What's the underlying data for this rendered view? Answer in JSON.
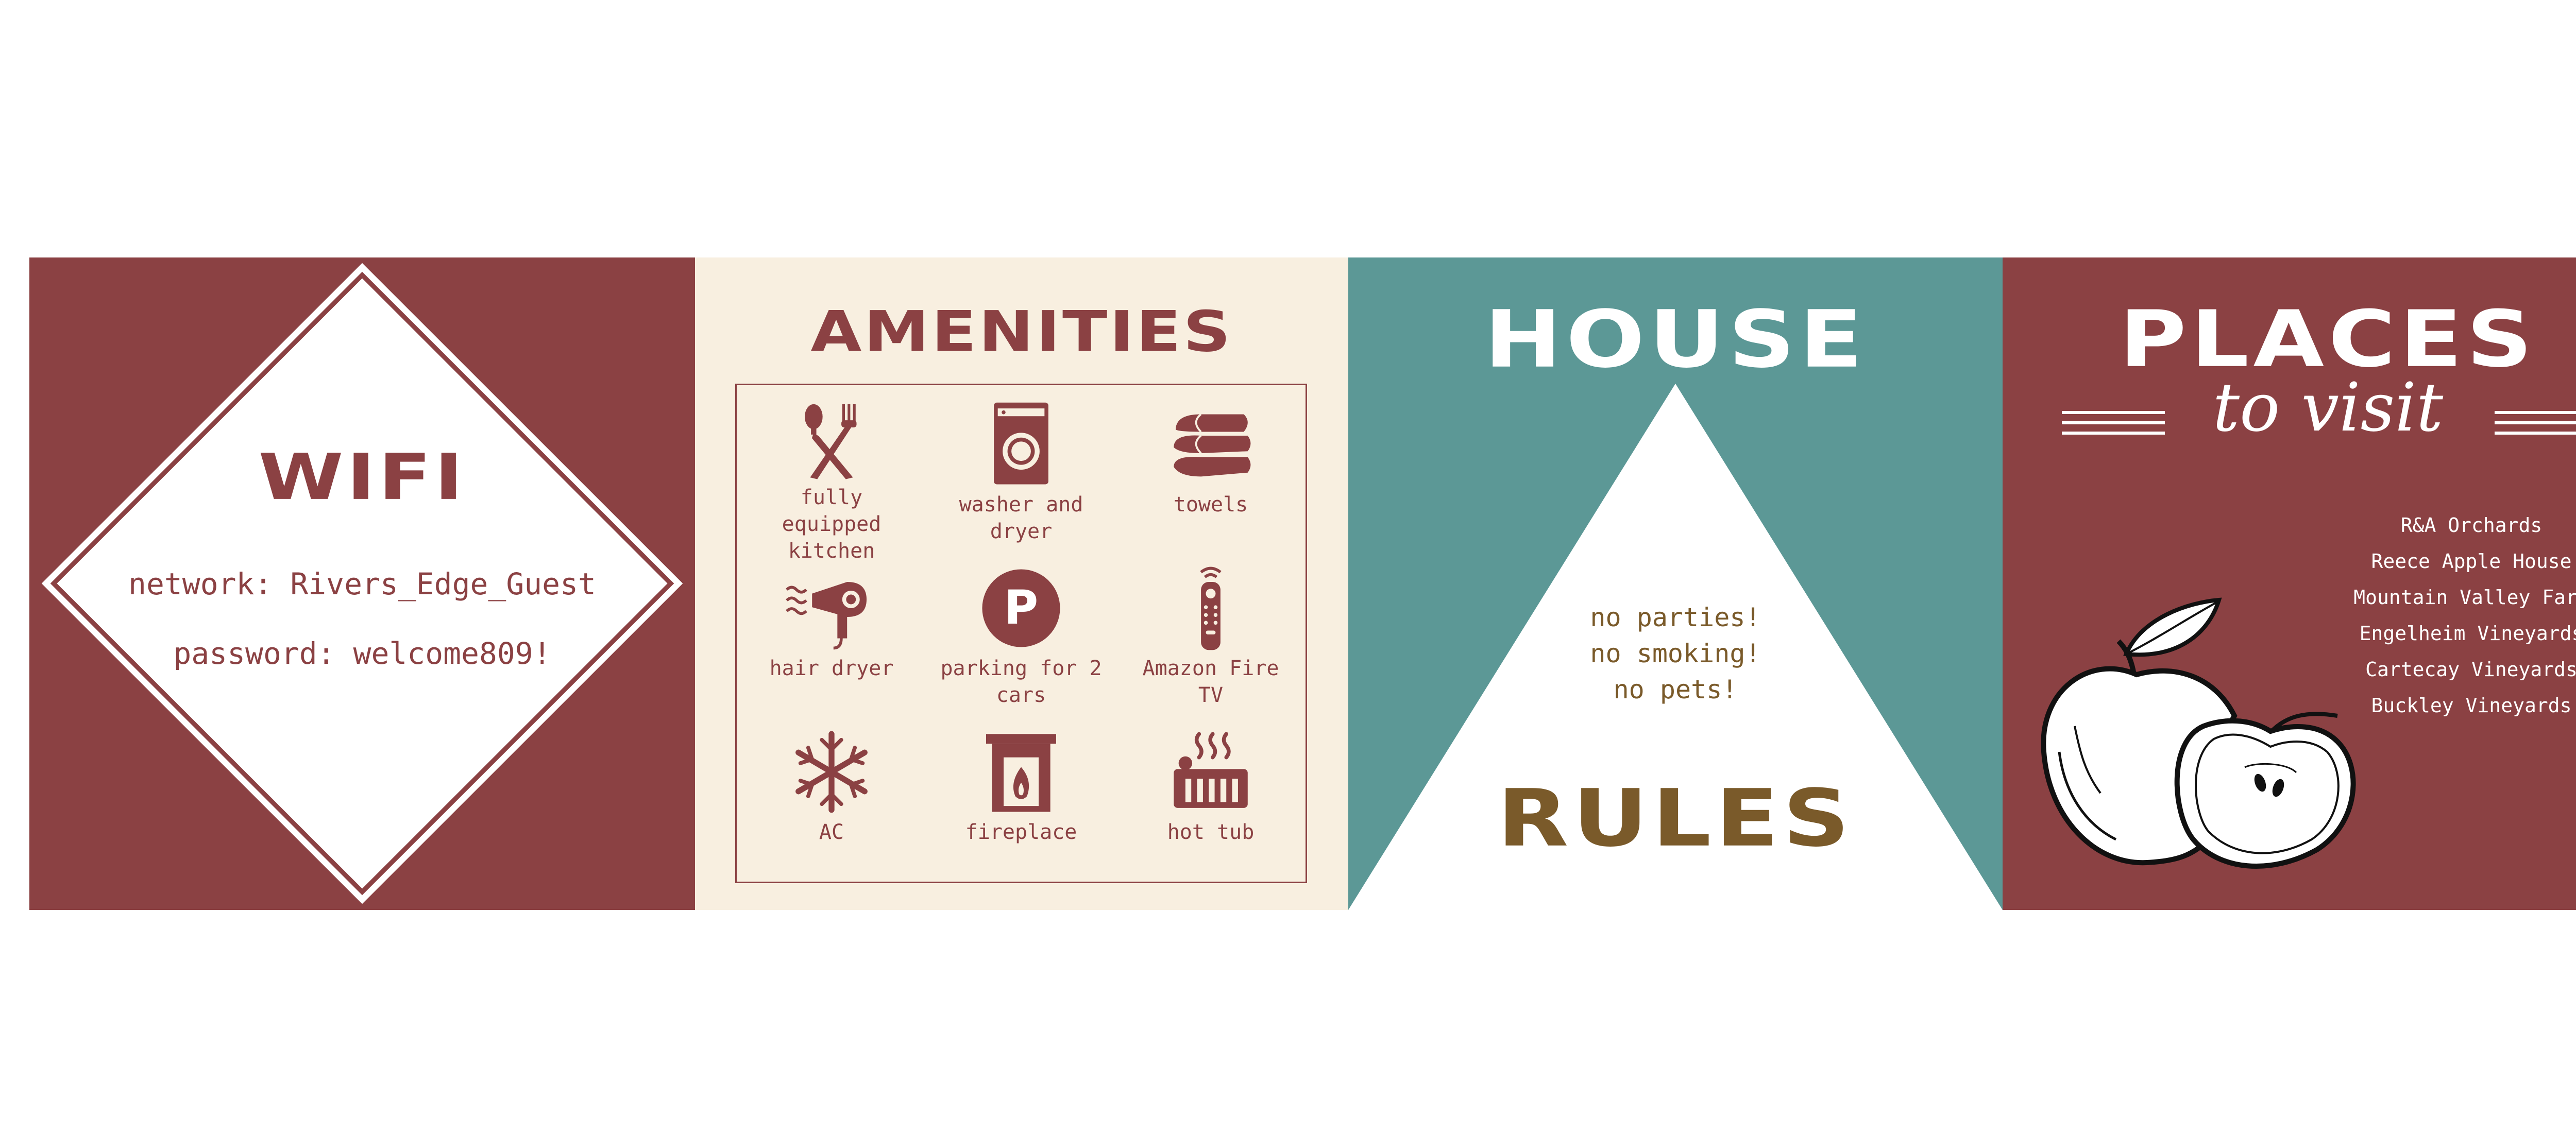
{
  "wifi": {
    "title": "WIFI",
    "network": "network: Rivers_Edge_Guest",
    "password": "password: welcome809!"
  },
  "amenities": {
    "title": "AMENITIES",
    "items": [
      {
        "label": "fully equipped kitchen",
        "icon": "fork-spoon-icon"
      },
      {
        "label": "washer and dryer",
        "icon": "washing-machine-icon"
      },
      {
        "label": "towels",
        "icon": "towels-icon"
      },
      {
        "label": "hair dryer",
        "icon": "hair-dryer-icon"
      },
      {
        "label": "parking for 2 cars",
        "icon": "parking-icon"
      },
      {
        "label": "Amazon Fire TV",
        "icon": "remote-control-icon"
      },
      {
        "label": "AC",
        "icon": "snowflake-icon"
      },
      {
        "label": "fireplace",
        "icon": "fireplace-icon"
      },
      {
        "label": "hot tub",
        "icon": "hot-tub-icon"
      }
    ],
    "parking_letter": "P"
  },
  "rules": {
    "title_top": "HOUSE",
    "title_bottom": "RULES",
    "items": [
      "no parties!",
      "no smoking!",
      "no pets!"
    ]
  },
  "places": {
    "title": "PLACES",
    "subtitle": "to visit",
    "items": [
      "R&A Orchards",
      "Reece Apple House",
      "Mountain Valley Farm",
      "Engelheim Vineyards",
      "Cartecay Vineyards",
      "Buckley Vineyards"
    ]
  },
  "colors": {
    "maroon": "#8b4143",
    "cream": "#f8efe0",
    "teal": "#5c9896",
    "brown": "#7a5a2a",
    "white": "#ffffff"
  }
}
